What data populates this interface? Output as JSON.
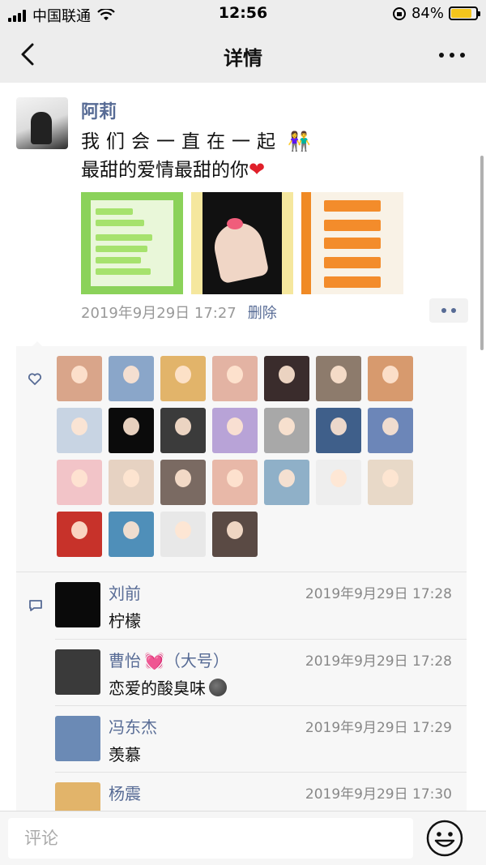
{
  "status_bar": {
    "carrier": "中国联通",
    "time": "12:56",
    "battery": "84%",
    "battery_level": 0.84
  },
  "nav": {
    "title": "详情"
  },
  "post": {
    "author": "阿莉",
    "line1": "我们会一直在一起",
    "line1_emoji": "👫",
    "line2": "最甜的爱情最甜的你",
    "line2_emoji": "❤",
    "timestamp": "2019年9月29日 17:27",
    "delete_label": "删除"
  },
  "likes": {
    "avatar_colors": [
      "#d9a58a",
      "#8aa6c9",
      "#e2b46a",
      "#e3b3a3",
      "#3a2c2c",
      "#8d7b6c",
      "#d79a6e",
      "#c8d4e3",
      "#0b0b0b",
      "#3b3b3b",
      "#b8a3d7",
      "#a8a8a8",
      "#3f5f8a",
      "#6c86b8",
      "#f2c4c8",
      "#e6d2c2",
      "#7a6a62",
      "#e8b8a8",
      "#8fb0c8",
      "#eeeeee",
      "#e8d9c8",
      "#c7322a",
      "#4f8fb9",
      "#e8e8e8",
      "#5a4a44"
    ]
  },
  "comments": [
    {
      "name": "刘前",
      "name_suffix": "",
      "time": "2019年9月29日 17:28",
      "text": "柠檬",
      "avatar_color": "#0a0a0a"
    },
    {
      "name": "曹怡",
      "name_suffix": "💓（大号）",
      "time": "2019年9月29日 17:28",
      "text": "恋爱的酸臭味",
      "avatar_color": "#3a3a3a"
    },
    {
      "name": "冯东杰",
      "name_suffix": "",
      "time": "2019年9月29日 17:29",
      "text": "羡慕",
      "avatar_color": "#6b8ab5"
    },
    {
      "name": "杨震",
      "name_suffix": "",
      "time": "2019年9月29日 17:30",
      "text": "",
      "avatar_color": "#e2b46a"
    }
  ],
  "input_bar": {
    "placeholder": "评论"
  }
}
